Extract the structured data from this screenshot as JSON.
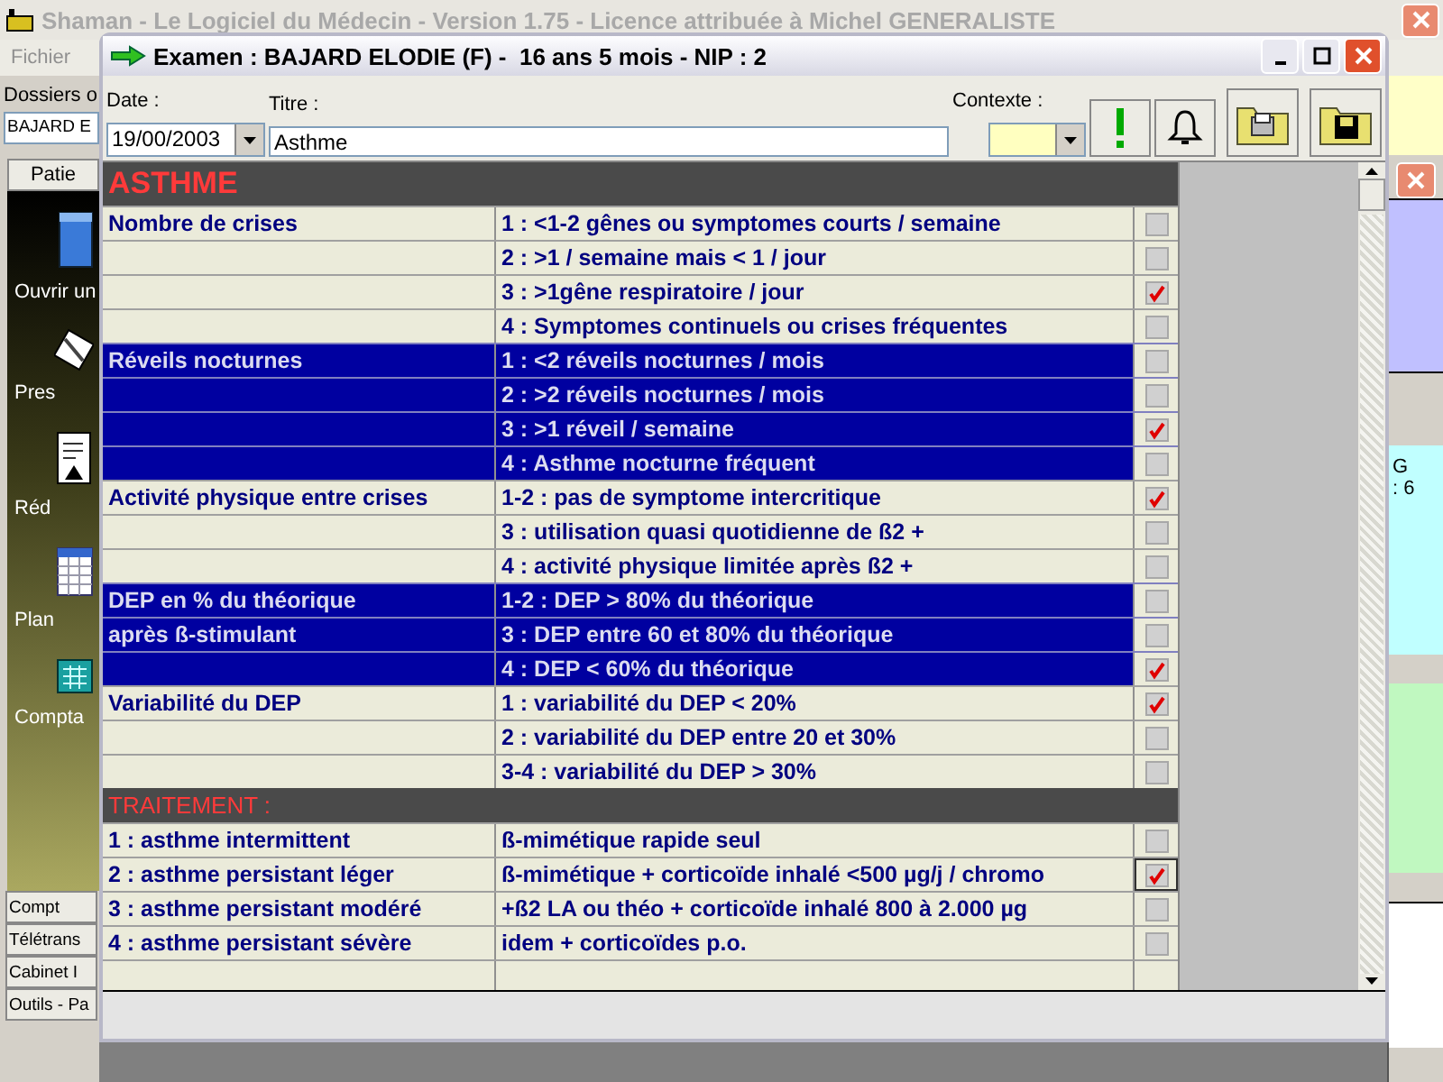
{
  "app": {
    "title": "Shaman - Le Logiciel du Médecin - Version 1.75 - Licence attribuée à Michel GENERALISTE",
    "menu": [
      "Fichier"
    ],
    "folder_label": "Dossiers o",
    "patient_field": "BAJARD E",
    "top_tab": "Patie",
    "launcher": [
      {
        "kind": "folder",
        "label": "Ouvrir un"
      },
      {
        "kind": "pen",
        "label": "Pres"
      },
      {
        "kind": "document",
        "label": "Réd"
      },
      {
        "kind": "calendar",
        "label": "Plan"
      },
      {
        "kind": "calculator",
        "label": "Compta"
      }
    ],
    "bottom_tabs": [
      "Compt",
      "Télétrans",
      "Cabinet I",
      "Outils - Pa"
    ],
    "side_texts": [
      "G",
      ": 6"
    ]
  },
  "dialog": {
    "title": "Examen : BAJARD ELODIE (F) -  16 ans 5 mois - NIP : 2",
    "date_label": "Date :",
    "date": "19/00/2003",
    "title_label": "Titre :",
    "title_value": "Asthme",
    "context_label": "Contexte :"
  },
  "sections": [
    {
      "kind": "main",
      "title": "ASTHME",
      "rows": [
        {
          "label": "Nombre de crises",
          "text": "1 : <1-2 gênes ou symptomes courts / semaine",
          "checked": false,
          "highlighted": false,
          "focused": false
        },
        {
          "text": "2 : >1 / semaine mais < 1 / jour",
          "checked": false,
          "highlighted": false,
          "focused": false
        },
        {
          "text": "3 : >1gêne respiratoire / jour",
          "checked": true,
          "highlighted": false,
          "focused": false
        },
        {
          "text": "4 : Symptomes continuels ou crises fréquentes",
          "checked": false,
          "highlighted": false,
          "focused": false
        },
        {
          "label": "Réveils nocturnes",
          "text": "1 : <2 réveils nocturnes / mois",
          "checked": false,
          "highlighted": true,
          "focused": false
        },
        {
          "text": "2 : >2 réveils nocturnes / mois",
          "checked": false,
          "highlighted": true,
          "focused": false
        },
        {
          "text": "3 : >1 réveil / semaine",
          "checked": true,
          "highlighted": true,
          "focused": false
        },
        {
          "text": "4 : Asthme nocturne fréquent",
          "checked": false,
          "highlighted": true,
          "focused": false
        },
        {
          "label": "Activité physique entre crises",
          "text": "1-2 : pas de symptome intercritique",
          "checked": true,
          "highlighted": false,
          "focused": false
        },
        {
          "text": "3 : utilisation quasi quotidienne de ß2 +",
          "checked": false,
          "highlighted": false,
          "focused": false
        },
        {
          "text": "4 : activité physique limitée après ß2 +",
          "checked": false,
          "highlighted": false,
          "focused": false
        },
        {
          "label": "DEP en % du théorique",
          "text": "1-2 : DEP > 80% du théorique",
          "checked": false,
          "highlighted": true,
          "focused": false
        },
        {
          "label": "après ß-stimulant",
          "text": "3 : DEP entre 60 et 80% du théorique",
          "checked": false,
          "highlighted": true,
          "focused": false
        },
        {
          "text": "4 : DEP < 60% du théorique",
          "checked": true,
          "highlighted": true,
          "focused": false
        },
        {
          "label": "Variabilité du DEP",
          "text": "1 : variabilité du DEP < 20%",
          "checked": true,
          "highlighted": false,
          "focused": false
        },
        {
          "text": "2 : variabilité du DEP entre 20 et 30%",
          "checked": false,
          "highlighted": false,
          "focused": false
        },
        {
          "text": "3-4 : variabilité du DEP > 30%",
          "checked": false,
          "highlighted": false,
          "focused": false
        }
      ]
    },
    {
      "kind": "sub",
      "title": "TRAITEMENT :",
      "rows": [
        {
          "label": "1 : asthme intermittent",
          "text": "ß-mimétique rapide seul",
          "checked": false,
          "highlighted": false,
          "focused": false
        },
        {
          "label": "2 : asthme persistant léger",
          "text": "ß-mimétique + corticoïde inhalé <500 µg/j / chromo",
          "checked": true,
          "highlighted": false,
          "focused": true
        },
        {
          "label": "3 : asthme persistant modéré",
          "text": "+ß2 LA ou théo + corticoïde inhalé 800 à 2.000 µg",
          "checked": false,
          "highlighted": false,
          "focused": false
        },
        {
          "label": "4 : asthme persistant sévère",
          "text": "idem + corticoïdes p.o.",
          "checked": false,
          "highlighted": false,
          "focused": false
        }
      ]
    }
  ]
}
